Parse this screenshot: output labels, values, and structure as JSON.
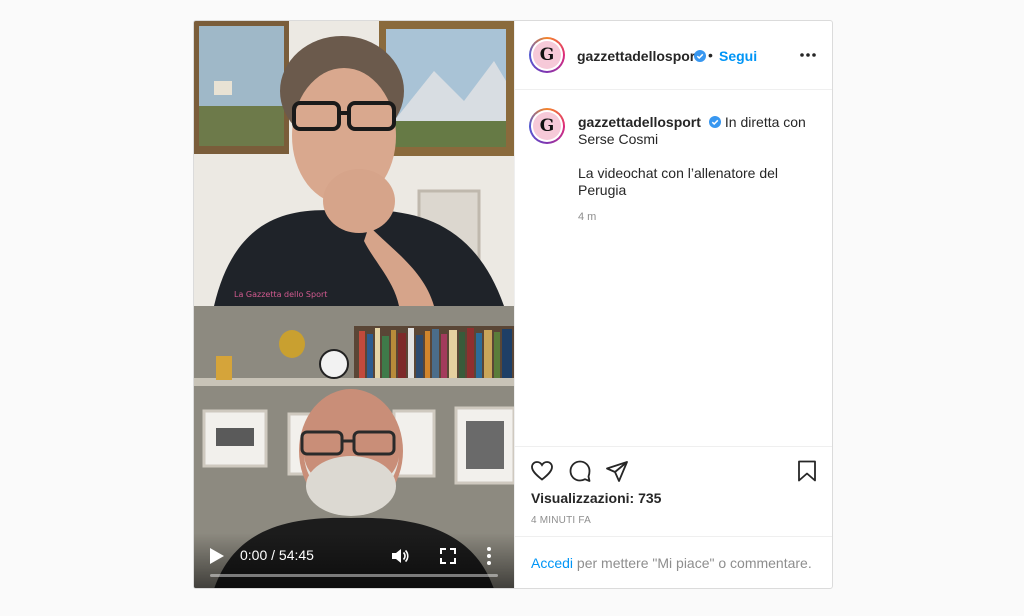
{
  "post": {
    "username": "gazzettadellosport",
    "avatar_letter": "G",
    "follow_label": "Segui",
    "separator": "•",
    "caption_text": "In diretta con Serse Cosmi",
    "caption_desc": "La videochat con l’allenatore del Perugia",
    "caption_time": "4 m"
  },
  "video": {
    "time": "0:00 / 54:45",
    "progress": 0
  },
  "stats": {
    "views": "Visualizzazioni: 735",
    "time_ago": "4 minuti fa"
  },
  "login": {
    "link": "Accedi",
    "text": " per mettere \"Mi piace\" o commentare."
  },
  "colors": {
    "link_blue": "#0095f6",
    "verified_blue": "#3897f0"
  }
}
